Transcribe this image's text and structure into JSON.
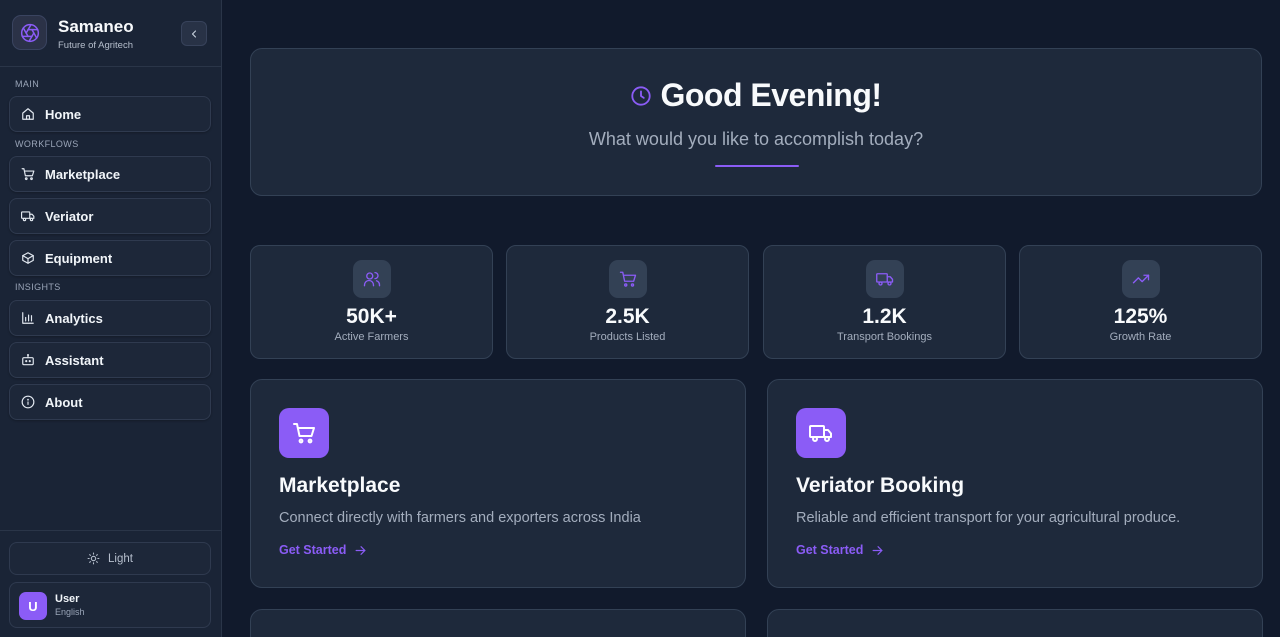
{
  "brand": {
    "name": "Samaneo",
    "tagline": "Future of Agritech"
  },
  "sidebar": {
    "sections": {
      "main": "MAIN",
      "workflows": "WORKFLOWS",
      "insights": "INSIGHTS"
    },
    "items": [
      {
        "label": "Home",
        "icon": "home-icon"
      },
      {
        "label": "Marketplace",
        "icon": "cart-icon"
      },
      {
        "label": "Veriator",
        "icon": "truck-icon"
      },
      {
        "label": "Equipment",
        "icon": "box-icon"
      },
      {
        "label": "Analytics",
        "icon": "bar-chart-icon"
      },
      {
        "label": "Assistant",
        "icon": "bot-icon"
      },
      {
        "label": "About",
        "icon": "info-icon"
      }
    ],
    "theme_toggle": "Light",
    "user": {
      "initial": "U",
      "name": "User",
      "language": "English"
    }
  },
  "greeting": {
    "title": "Good Evening!",
    "subtitle": "What would you like to accomplish today?"
  },
  "stats": [
    {
      "value": "50K+",
      "label": "Active Farmers",
      "icon": "users-icon"
    },
    {
      "value": "2.5K",
      "label": "Products Listed",
      "icon": "cart-icon"
    },
    {
      "value": "1.2K",
      "label": "Transport Bookings",
      "icon": "truck-icon"
    },
    {
      "value": "125%",
      "label": "Growth Rate",
      "icon": "trending-up-icon"
    }
  ],
  "features": [
    {
      "title": "Marketplace",
      "description": "Connect directly with farmers and exporters across India",
      "cta": "Get Started",
      "icon": "cart-icon"
    },
    {
      "title": "Veriator Booking",
      "description": "Reliable and efficient transport for your agricultural produce.",
      "cta": "Get Started",
      "icon": "truck-icon"
    }
  ],
  "colors": {
    "accent": "#8b5cf6",
    "background": "#111a2c",
    "card": "#1e293b",
    "sidebar": "#1a2436"
  }
}
